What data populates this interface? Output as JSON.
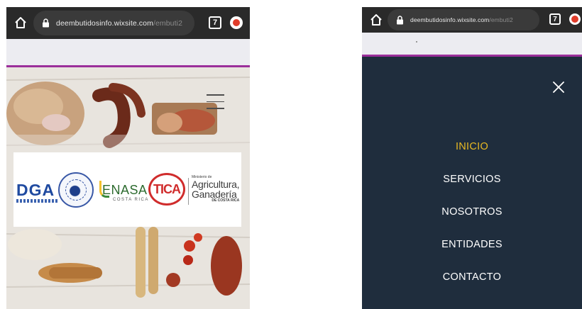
{
  "left_phone": {
    "browser": {
      "url_domain": "deembutidosinfo.wixsite.com",
      "url_path": "/embuti2",
      "tab_count": "7",
      "icons": [
        "home-icon",
        "lock-icon",
        "tabs-icon",
        "extension-icon"
      ]
    },
    "logos": {
      "dga": "DGA",
      "senasa": "ENASA",
      "senasa_sub": "COSTA RICA",
      "tica": "TICA",
      "agri_ministry": "Ministerio de",
      "agri_line1": "Agricultura,",
      "agri_line2": "Ganadería",
      "agri_country": "DE COSTA RICA"
    }
  },
  "right_phone": {
    "browser": {
      "url_domain": "deembutidosinfo.wixsite.com",
      "url_path": "/embuti2",
      "tab_count": "7"
    },
    "menu": [
      {
        "label": "INICIO",
        "active": true
      },
      {
        "label": "SERVICIOS",
        "active": false
      },
      {
        "label": "NOSOTROS",
        "active": false
      },
      {
        "label": "ENTIDADES",
        "active": false
      },
      {
        "label": "CONTACTO",
        "active": false
      }
    ],
    "colors": {
      "panel": "#1f2d3d",
      "active": "#e8b923",
      "accent_line": "#9b2f9b"
    }
  }
}
